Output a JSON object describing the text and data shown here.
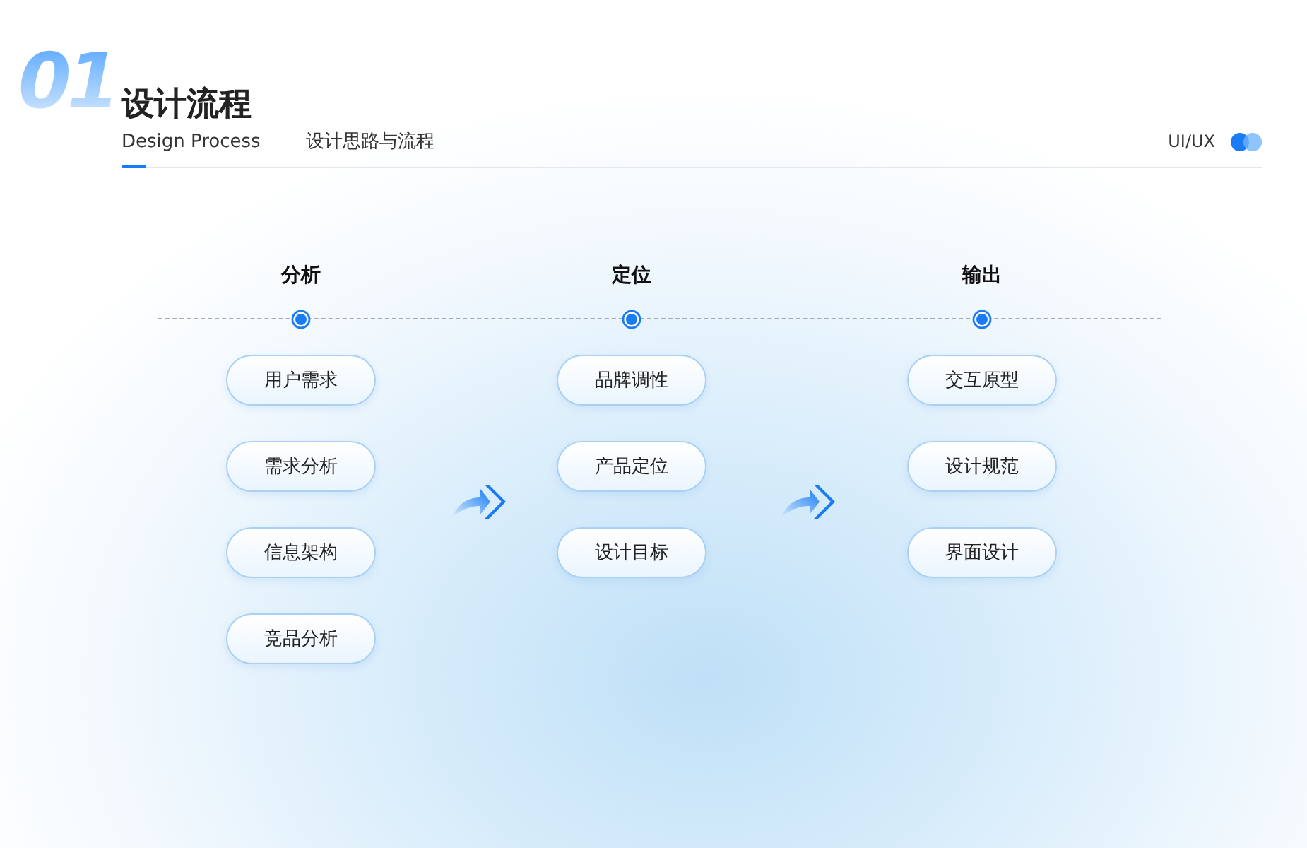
{
  "header": {
    "number": "01",
    "title": "设计流程",
    "subtitle": "Design Process",
    "caption": "设计思路与流程",
    "tag": "UI/UX"
  },
  "stages": [
    {
      "title": "分析",
      "items": [
        "用户需求",
        "需求分析",
        "信息架构",
        "竞品分析"
      ]
    },
    {
      "title": "定位",
      "items": [
        "品牌调性",
        "产品定位",
        "设计目标"
      ]
    },
    {
      "title": "输出",
      "items": [
        "交互原型",
        "设计规范",
        "界面设计"
      ]
    }
  ]
}
